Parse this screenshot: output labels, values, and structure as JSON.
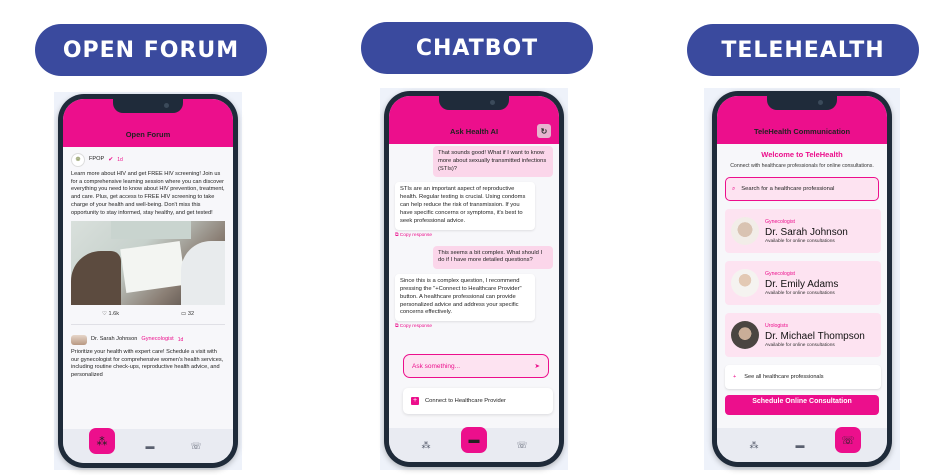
{
  "labels": {
    "forum": "OPEN FORUM",
    "chatbot": "CHATBOT",
    "telehealth": "TELEHEALTH"
  },
  "forum": {
    "title": "Open Forum",
    "post1": {
      "author": "FPOP",
      "time": "1d",
      "body": "Learn more about HIV and get FREE HIV screening! Join us for a comprehensive learning session where you can discover everything you need to know about HIV prevention, treatment, and care. Plus, get access to FREE HIV screening to take charge of your health and well-being. Don't miss this opportunity to stay informed, stay healthy, and get tested!",
      "likes": "1.6k",
      "comments": "32"
    },
    "post2": {
      "author": "Dr. Sarah Johnson",
      "role": "Gynecologist",
      "time": "1d",
      "body": "Prioritize your health with expert care! Schedule a visit with our gynecologist for comprehensive women's health services, including routine check-ups, reproductive health advice, and personalized"
    }
  },
  "chatbot": {
    "title": "Ask Health AI",
    "messages": [
      "That sounds good! What if I want to know more about sexually transmitted infections (STIs)?",
      "STIs are an important aspect of reproductive health. Regular testing is crucial. Using condoms can help reduce the risk of transmission. If you have specific concerns or symptoms, it's best to seek professional advice.",
      "This seems a bit complex. What should I do if I have more detailed questions?",
      "Since this is a complex question, I recommend pressing the \"+Connect to Healthcare Provider\" button. A healthcare professional can provide personalized advice and address your specific concerns effectively."
    ],
    "copy_label": "Copy response",
    "ask_placeholder": "Ask something...",
    "connect_label": "Connect to Healthcare Provider"
  },
  "telehealth": {
    "title": "TeleHealth Communication",
    "welcome": "Welcome to TeleHealth",
    "subtitle": "Connect with healthcare professionals for online consultations.",
    "search_placeholder": "Search for a healthcare professional",
    "available": "Available for online consultations",
    "doctors": [
      {
        "specialty": "Gynecologist",
        "name": "Dr. Sarah Johnson"
      },
      {
        "specialty": "Gynecologist",
        "name": "Dr. Emily Adams"
      },
      {
        "specialty": "Urologists",
        "name": "Dr. Michael Thompson"
      }
    ],
    "see_all": "See all healthcare professionals",
    "schedule": "Schedule Online Consultation"
  },
  "colors": {
    "brand": "#ec0f8c",
    "label_pill": "#3a4a9e"
  }
}
